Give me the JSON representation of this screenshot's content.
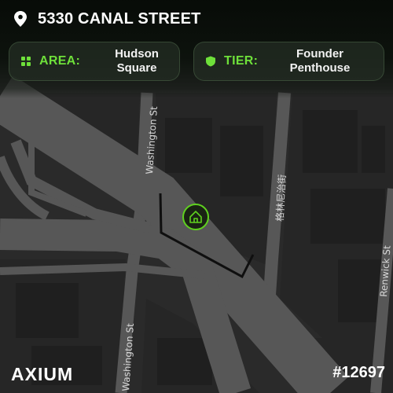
{
  "header": {
    "address": "5330 CANAL STREET",
    "icon": "location-pin-icon"
  },
  "area": {
    "label": "AREA:",
    "value_line1": "Hudson",
    "value_line2": "Square",
    "icon": "grid-icon"
  },
  "tier": {
    "label": "TIER:",
    "value_line1": "Founder",
    "value_line2": "Penthouse",
    "icon": "shield-icon"
  },
  "map": {
    "streets": {
      "washington_north": "Washington St",
      "washington_south": "Washington St",
      "chinese": "格林尼治街",
      "renwick": "Renwick St"
    },
    "marker_icon": "home-icon"
  },
  "brand": {
    "logo": "AXIUM"
  },
  "token": {
    "id": "#12697"
  },
  "colors": {
    "accent": "#6ee03a",
    "marker": "#5fd11f",
    "map_block": "#2b2b2b",
    "map_road": "#5a5a5a"
  }
}
